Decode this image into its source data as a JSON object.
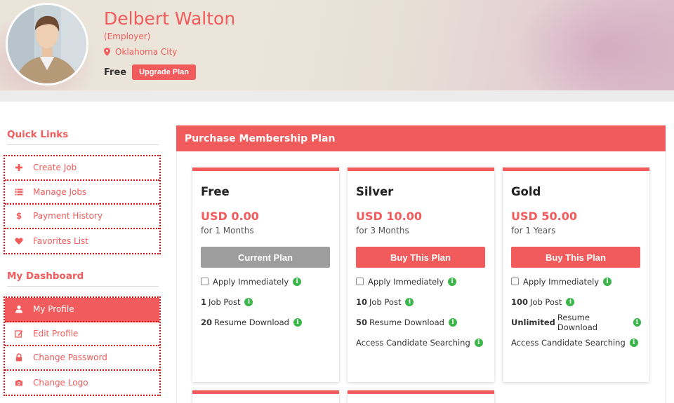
{
  "profile": {
    "name": "Delbert Walton",
    "role": "(Employer)",
    "location": "Oklahoma City",
    "plan": "Free",
    "upgrade_label": "Upgrade Plan"
  },
  "sidebar": {
    "quick_links_heading": "Quick Links",
    "quick_links": [
      {
        "label": "Create Job",
        "icon": "plus-icon"
      },
      {
        "label": "Manage Jobs",
        "icon": "list-icon"
      },
      {
        "label": "Payment History",
        "icon": "dollar-icon"
      },
      {
        "label": "Favorites List",
        "icon": "heart-icon"
      }
    ],
    "dashboard_heading": "My Dashboard",
    "dashboard_links": [
      {
        "label": "My Profile",
        "icon": "user-icon",
        "active": true
      },
      {
        "label": "Edit Profile",
        "icon": "edit-icon"
      },
      {
        "label": "Change Password",
        "icon": "lock-icon"
      },
      {
        "label": "Change Logo",
        "icon": "camera-icon"
      }
    ]
  },
  "membership": {
    "heading": "Purchase Membership Plan",
    "plans": [
      {
        "name": "Free",
        "price": "USD 0.00",
        "duration": "for 1 Months",
        "button": "Current Plan",
        "apply": "Apply Immediately",
        "job_post_count": "1",
        "job_post_label": "Job Post",
        "resume_count": "20",
        "resume_label": "Resume Download",
        "search": ""
      },
      {
        "name": "Silver",
        "price": "USD 10.00",
        "duration": "for 3 Months",
        "button": "Buy This Plan",
        "apply": "Apply Immediately",
        "job_post_count": "10",
        "job_post_label": "Job Post",
        "resume_count": "50",
        "resume_label": "Resume Download",
        "search": "Access Candidate Searching"
      },
      {
        "name": "Gold",
        "price": "USD 50.00",
        "duration": "for 1 Years",
        "button": "Buy This Plan",
        "apply": "Apply Immediately",
        "job_post_count": "100",
        "job_post_label": "Job Post",
        "resume_count": "Unlimited",
        "resume_label": "Resume Download",
        "search": "Access Candidate Searching"
      }
    ]
  },
  "colors": {
    "accent": "#f25b5b",
    "button_gray": "#9e9e9e",
    "info_green": "#3cb54a"
  }
}
